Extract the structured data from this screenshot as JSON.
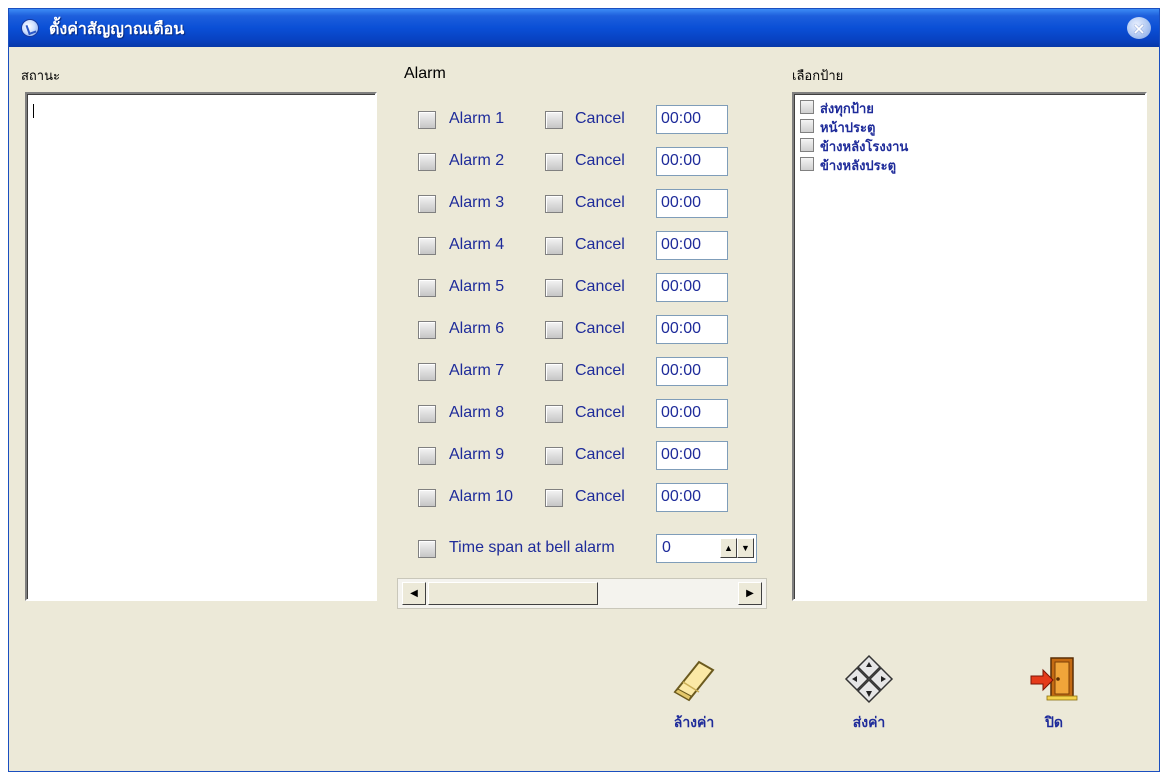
{
  "window": {
    "title": "ตั้งค่าสัญญาณเตือน",
    "close_glyph": "×"
  },
  "status": {
    "label": "สถานะ",
    "text": ""
  },
  "alarm": {
    "label": "Alarm",
    "rows": [
      {
        "label": "Alarm 1",
        "cancel_label": "Cancel",
        "time": "00:00"
      },
      {
        "label": "Alarm 2",
        "cancel_label": "Cancel",
        "time": "00:00"
      },
      {
        "label": "Alarm 3",
        "cancel_label": "Cancel",
        "time": "00:00"
      },
      {
        "label": "Alarm 4",
        "cancel_label": "Cancel",
        "time": "00:00"
      },
      {
        "label": "Alarm 5",
        "cancel_label": "Cancel",
        "time": "00:00"
      },
      {
        "label": "Alarm 6",
        "cancel_label": "Cancel",
        "time": "00:00"
      },
      {
        "label": "Alarm 7",
        "cancel_label": "Cancel",
        "time": "00:00"
      },
      {
        "label": "Alarm 8",
        "cancel_label": "Cancel",
        "time": "00:00"
      },
      {
        "label": "Alarm 9",
        "cancel_label": "Cancel",
        "time": "00:00"
      },
      {
        "label": "Alarm 10",
        "cancel_label": "Cancel",
        "time": "00:00"
      }
    ],
    "time_span": {
      "label": "Time span at bell alarm",
      "value": "0"
    }
  },
  "signs": {
    "label": "เลือกป้าย",
    "items": [
      "ส่งทุกป้าย",
      "หน้าประตู",
      "ข้างหลังโรงงาน",
      "ข้างหลังประตู"
    ]
  },
  "buttons": {
    "clear_label": "ล้างค่า",
    "send_label": "ส่งค่า",
    "close_label": "ปิด"
  },
  "icons": {
    "app": "bell-icon",
    "clear": "eraser-icon",
    "send": "diamond-arrows-icon",
    "close": "exit-door-icon"
  }
}
